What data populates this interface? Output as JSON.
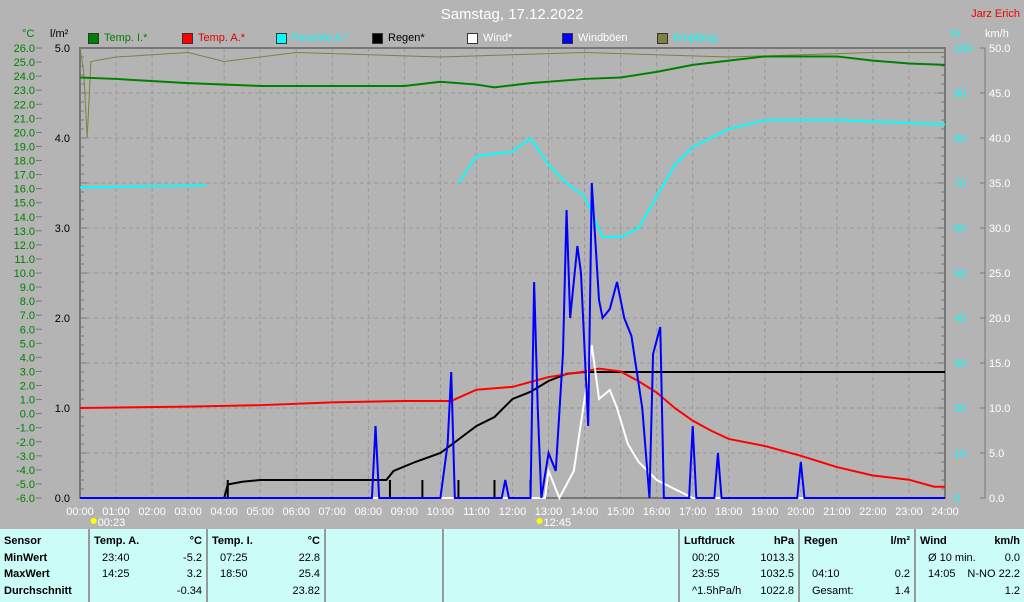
{
  "header": {
    "title": "Samstag, 17.12.2022",
    "author": "Jarz Erich"
  },
  "chart_data": {
    "type": "line",
    "title": "Samstag, 17.12.2022",
    "x_range": [
      0,
      24
    ],
    "x_ticks": [
      "00:00",
      "01:00",
      "02:00",
      "03:00",
      "04:00",
      "05:00",
      "06:00",
      "07:00",
      "08:00",
      "09:00",
      "10:00",
      "11:00",
      "12:00",
      "13:00",
      "14:00",
      "15:00",
      "16:00",
      "17:00",
      "18:00",
      "19:00",
      "20:00",
      "21:00",
      "22:00",
      "23:00",
      "24:00"
    ],
    "axes": {
      "temp": {
        "unit": "°C",
        "range": [
          -6,
          26
        ],
        "ticks": [
          "26.0",
          "25.0",
          "24.0",
          "23.0",
          "22.0",
          "21.0",
          "20.0",
          "19.0",
          "18.0",
          "17.0",
          "16.0",
          "15.0",
          "14.0",
          "13.0",
          "12.0",
          "11.0",
          "10.0",
          "9.0",
          "8.0",
          "7.0",
          "6.0",
          "5.0",
          "4.0",
          "3.0",
          "2.0",
          "1.0",
          "0.0",
          "-1.0",
          "-2.0",
          "-3.0",
          "-4.0",
          "-5.0",
          "-6.0"
        ]
      },
      "rain": {
        "unit": "l/m²",
        "range": [
          0,
          5
        ],
        "ticks": [
          "5.0",
          "4.0",
          "3.0",
          "2.0",
          "1.0",
          "0.0"
        ]
      },
      "humidity": {
        "unit": "%",
        "range": [
          0,
          100
        ],
        "ticks": [
          "100",
          "90",
          "80",
          "70",
          "60",
          "50",
          "40",
          "30",
          "20",
          "10",
          "0"
        ]
      },
      "wind": {
        "unit": "km/h",
        "range": [
          0,
          50
        ],
        "ticks": [
          "50.0",
          "45.0",
          "40.0",
          "35.0",
          "30.0",
          "25.0",
          "20.0",
          "15.0",
          "10.0",
          "5.0",
          "0.0"
        ]
      }
    },
    "series": [
      {
        "name": "Temp. I.*",
        "color": "#008000",
        "axis": "temp",
        "points": [
          [
            0,
            23.9
          ],
          [
            1,
            23.8
          ],
          [
            3,
            23.5
          ],
          [
            5,
            23.3
          ],
          [
            7,
            23.3
          ],
          [
            9,
            23.3
          ],
          [
            10,
            23.6
          ],
          [
            11,
            23.4
          ],
          [
            11.5,
            23.2
          ],
          [
            12.5,
            23.5
          ],
          [
            14,
            23.8
          ],
          [
            15,
            23.9
          ],
          [
            16,
            24.3
          ],
          [
            17,
            24.8
          ],
          [
            18,
            25.1
          ],
          [
            19,
            25.4
          ],
          [
            21,
            25.4
          ],
          [
            22,
            25.1
          ],
          [
            23,
            24.9
          ],
          [
            24,
            24.8
          ]
        ]
      },
      {
        "name": "Temp. A.*",
        "color": "#ff0000",
        "axis": "temp",
        "points": [
          [
            0,
            0.4
          ],
          [
            3,
            0.5
          ],
          [
            5,
            0.6
          ],
          [
            7,
            0.8
          ],
          [
            9,
            0.9
          ],
          [
            10.3,
            0.9
          ],
          [
            11,
            1.7
          ],
          [
            12,
            1.9
          ],
          [
            13,
            2.6
          ],
          [
            14,
            3.0
          ],
          [
            14.4,
            3.2
          ],
          [
            15,
            3.0
          ],
          [
            15.5,
            2.3
          ],
          [
            16,
            1.5
          ],
          [
            16.5,
            0.4
          ],
          [
            17,
            -0.5
          ],
          [
            17.5,
            -1.2
          ],
          [
            18,
            -1.8
          ],
          [
            19,
            -2.3
          ],
          [
            20,
            -3.0
          ],
          [
            21,
            -3.8
          ],
          [
            22,
            -4.4
          ],
          [
            23,
            -4.7
          ],
          [
            23.7,
            -5.2
          ],
          [
            24,
            -5.2
          ]
        ]
      },
      {
        "name": "Feuchte A.*",
        "color": "#00ffff",
        "axis": "humidity",
        "points": [
          [
            0,
            69
          ],
          [
            3.5,
            69.5
          ]
        ],
        "points2": [
          [
            10.5,
            70
          ],
          [
            11,
            76
          ],
          [
            12,
            77
          ],
          [
            12.5,
            80
          ],
          [
            13,
            74
          ],
          [
            13.5,
            70
          ],
          [
            14,
            67
          ],
          [
            14.5,
            58
          ],
          [
            15,
            58
          ],
          [
            15.5,
            60
          ],
          [
            16,
            67
          ],
          [
            16.5,
            74
          ],
          [
            17,
            78
          ],
          [
            18,
            82
          ],
          [
            19,
            84
          ],
          [
            21,
            84
          ],
          [
            24,
            83
          ]
        ]
      },
      {
        "name": "Regen*",
        "color": "#000000",
        "axis": "rain",
        "points": [
          [
            0,
            0
          ],
          [
            4,
            0
          ],
          [
            4.1,
            0.15
          ],
          [
            4.5,
            0.18
          ],
          [
            5,
            0.2
          ],
          [
            8.5,
            0.2
          ],
          [
            8.7,
            0.3
          ],
          [
            9.3,
            0.4
          ],
          [
            10,
            0.5
          ],
          [
            10.5,
            0.65
          ],
          [
            11,
            0.8
          ],
          [
            11.5,
            0.9
          ],
          [
            12,
            1.1
          ],
          [
            12.5,
            1.18
          ],
          [
            13,
            1.3
          ],
          [
            13.5,
            1.38
          ],
          [
            14,
            1.4
          ],
          [
            24,
            1.4
          ]
        ]
      },
      {
        "name": "Wind*",
        "color": "#ffffff",
        "axis": "wind",
        "points": [
          [
            0,
            0
          ],
          [
            12.9,
            0
          ],
          [
            13,
            3
          ],
          [
            13.3,
            0
          ],
          [
            13.7,
            3
          ],
          [
            14,
            11
          ],
          [
            14.2,
            17
          ],
          [
            14.4,
            11
          ],
          [
            14.7,
            12
          ],
          [
            14.9,
            10
          ],
          [
            15.2,
            6
          ],
          [
            15.5,
            4
          ],
          [
            16,
            2
          ],
          [
            16.5,
            1
          ],
          [
            17,
            0
          ],
          [
            24,
            0
          ]
        ]
      },
      {
        "name": "Windböen",
        "color": "#0000ff",
        "axis": "wind",
        "points": [
          [
            0,
            0
          ],
          [
            8.1,
            0
          ],
          [
            8.2,
            8
          ],
          [
            8.3,
            0
          ],
          [
            10,
            0
          ],
          [
            10.2,
            6
          ],
          [
            10.3,
            14
          ],
          [
            10.4,
            0
          ],
          [
            11.7,
            0
          ],
          [
            11.8,
            2
          ],
          [
            11.9,
            0
          ],
          [
            12.5,
            0
          ],
          [
            12.6,
            24
          ],
          [
            12.7,
            10
          ],
          [
            12.8,
            0
          ],
          [
            13,
            5
          ],
          [
            13.2,
            3
          ],
          [
            13.4,
            16
          ],
          [
            13.5,
            32
          ],
          [
            13.6,
            20
          ],
          [
            13.8,
            28
          ],
          [
            13.9,
            25
          ],
          [
            14.1,
            8
          ],
          [
            14.2,
            35
          ],
          [
            14.4,
            22
          ],
          [
            14.5,
            20
          ],
          [
            14.7,
            21
          ],
          [
            14.9,
            24
          ],
          [
            15.1,
            20
          ],
          [
            15.3,
            18
          ],
          [
            15.6,
            10
          ],
          [
            15.8,
            0
          ],
          [
            15.9,
            16
          ],
          [
            16.1,
            19
          ],
          [
            16.2,
            0
          ],
          [
            16.9,
            0
          ],
          [
            17,
            8
          ],
          [
            17.1,
            0
          ],
          [
            17.6,
            0
          ],
          [
            17.7,
            5
          ],
          [
            17.8,
            0
          ],
          [
            19.9,
            0
          ],
          [
            20,
            4
          ],
          [
            20.1,
            0
          ],
          [
            24,
            0
          ]
        ]
      },
      {
        "name": "Empfang",
        "color": "#808040",
        "axis": "humidity",
        "points": [
          [
            0,
            100
          ],
          [
            0.1,
            95
          ],
          [
            0.2,
            80
          ],
          [
            0.3,
            97
          ],
          [
            1,
            98
          ],
          [
            3,
            99
          ],
          [
            4,
            97
          ],
          [
            6,
            99
          ],
          [
            10,
            98
          ],
          [
            14,
            99
          ],
          [
            18,
            98
          ],
          [
            22,
            99
          ],
          [
            24,
            99
          ]
        ]
      }
    ],
    "rain_bars": [
      [
        4.1,
        0.2
      ],
      [
        8.6,
        0.2
      ],
      [
        9.5,
        0.2
      ],
      [
        10.5,
        0.2
      ],
      [
        11.5,
        0.2
      ],
      [
        12.5,
        0.2
      ]
    ],
    "markers": [
      {
        "symbol": "moonrise",
        "label": "00:23",
        "x": 0.38
      },
      {
        "symbol": "moonset",
        "label": "12:45",
        "x": 12.75
      }
    ]
  },
  "table": {
    "labels": [
      "Sensor",
      "MinWert",
      "MaxWert",
      "Durchschnitt"
    ],
    "temp_a": {
      "title": "Temp. A.",
      "unit": "°C",
      "rows": [
        [
          "23:40",
          "-5.2"
        ],
        [
          "14:25",
          "3.2"
        ],
        [
          "",
          "-0.34"
        ]
      ]
    },
    "temp_i": {
      "title": "Temp. I.",
      "unit": "°C",
      "rows": [
        [
          "07:25",
          "22.8"
        ],
        [
          "18:50",
          "25.4"
        ],
        [
          "",
          "23.82"
        ]
      ]
    },
    "pressure": {
      "title": "Luftdruck",
      "unit": "hPa",
      "rows": [
        [
          "00:20",
          "1013.3"
        ],
        [
          "23:55",
          "1032.5"
        ],
        [
          "^1.5hPa/h",
          "1022.8"
        ]
      ]
    },
    "rain": {
      "title": "Regen",
      "unit": "l/m²",
      "rows": [
        [
          "",
          ""
        ],
        [
          "04:10",
          "0.2"
        ],
        [
          "Gesamt:",
          "1.4"
        ]
      ]
    },
    "wind": {
      "title": "Wind",
      "unit": "km/h",
      "rows": [
        [
          "Ø 10 min.",
          "0.0"
        ],
        [
          "14:05",
          "N-NO 22.2"
        ],
        [
          "",
          "1.2"
        ]
      ]
    }
  }
}
